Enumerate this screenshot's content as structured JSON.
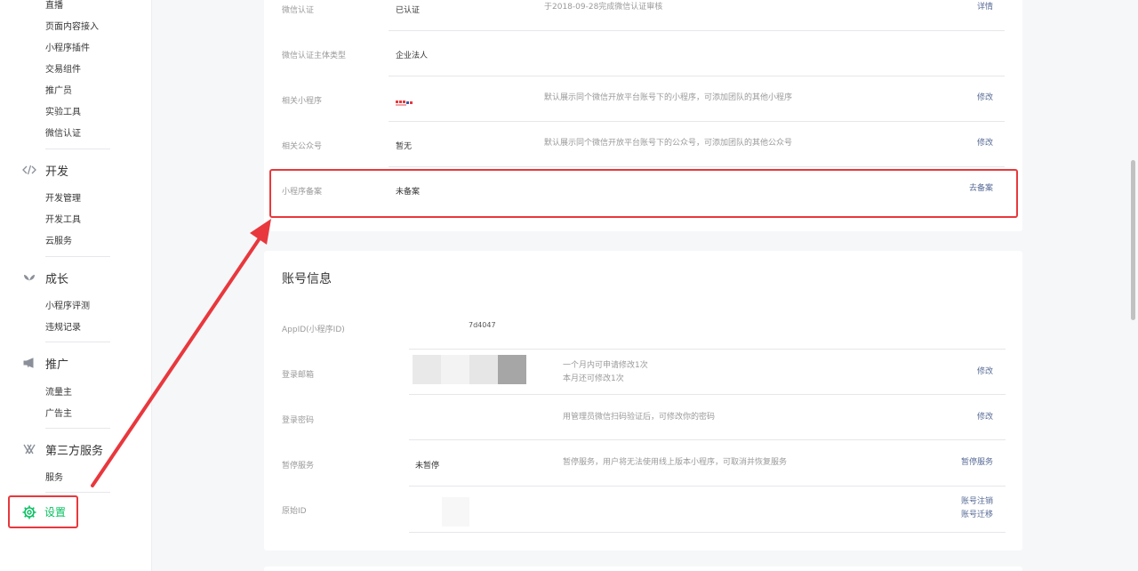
{
  "sidebar": {
    "items_top": [
      "直播",
      "页面内容接入",
      "小程序插件",
      "交易组件",
      "推广员",
      "实验工具",
      "微信认证"
    ],
    "dev": {
      "title": "开发",
      "icon": "code-icon",
      "items": [
        "开发管理",
        "开发工具",
        "云服务"
      ]
    },
    "growth": {
      "title": "成长",
      "icon": "sprout-icon",
      "items": [
        "小程序评测",
        "违规记录"
      ]
    },
    "promo": {
      "title": "推广",
      "icon": "megaphone-icon",
      "items": [
        "流量主",
        "广告主"
      ]
    },
    "third": {
      "title": "第三方服务",
      "icon": "third-party-icon",
      "items": [
        "服务"
      ]
    },
    "settings": {
      "title": "设置",
      "icon": "gear-icon"
    }
  },
  "basic": {
    "wechat_cert": {
      "label": "微信认证",
      "value": "已认证",
      "desc": "于2018-09-28完成微信认证审核",
      "action": "详情"
    },
    "cert_type": {
      "label": "微信认证主体类型",
      "value": "企业法人"
    },
    "related_mp": {
      "label": "相关小程序",
      "desc": "默认展示同个微信开放平台账号下的小程序，可添加团队的其他小程序",
      "action": "修改"
    },
    "related_oa": {
      "label": "相关公众号",
      "value": "暂无",
      "desc": "默认展示同个微信开放平台账号下的公众号，可添加团队的其他公众号",
      "action": "修改"
    },
    "filing": {
      "label": "小程序备案",
      "value": "未备案",
      "action": "去备案"
    }
  },
  "account": {
    "title": "账号信息",
    "appid": {
      "label": "AppID(小程序ID)",
      "value": "7d4047"
    },
    "email": {
      "label": "登录邮箱",
      "desc1": "一个月内可申请修改1次",
      "desc2": "本月还可修改1次",
      "action": "修改"
    },
    "password": {
      "label": "登录密码",
      "desc": "用管理员微信扫码验证后，可修改你的密码",
      "action": "修改"
    },
    "pause": {
      "label": "暂停服务",
      "value": "未暂停",
      "desc": "暂停服务，用户将无法使用线上版本小程序，可取消并恢复服务",
      "action": "暂停服务"
    },
    "origin": {
      "label": "原始ID",
      "action1": "账号注销",
      "action2": "账号迁移"
    }
  },
  "colors": {
    "accent_green": "#07c160",
    "link": "#576b95",
    "annotation_red": "#e8383d"
  }
}
